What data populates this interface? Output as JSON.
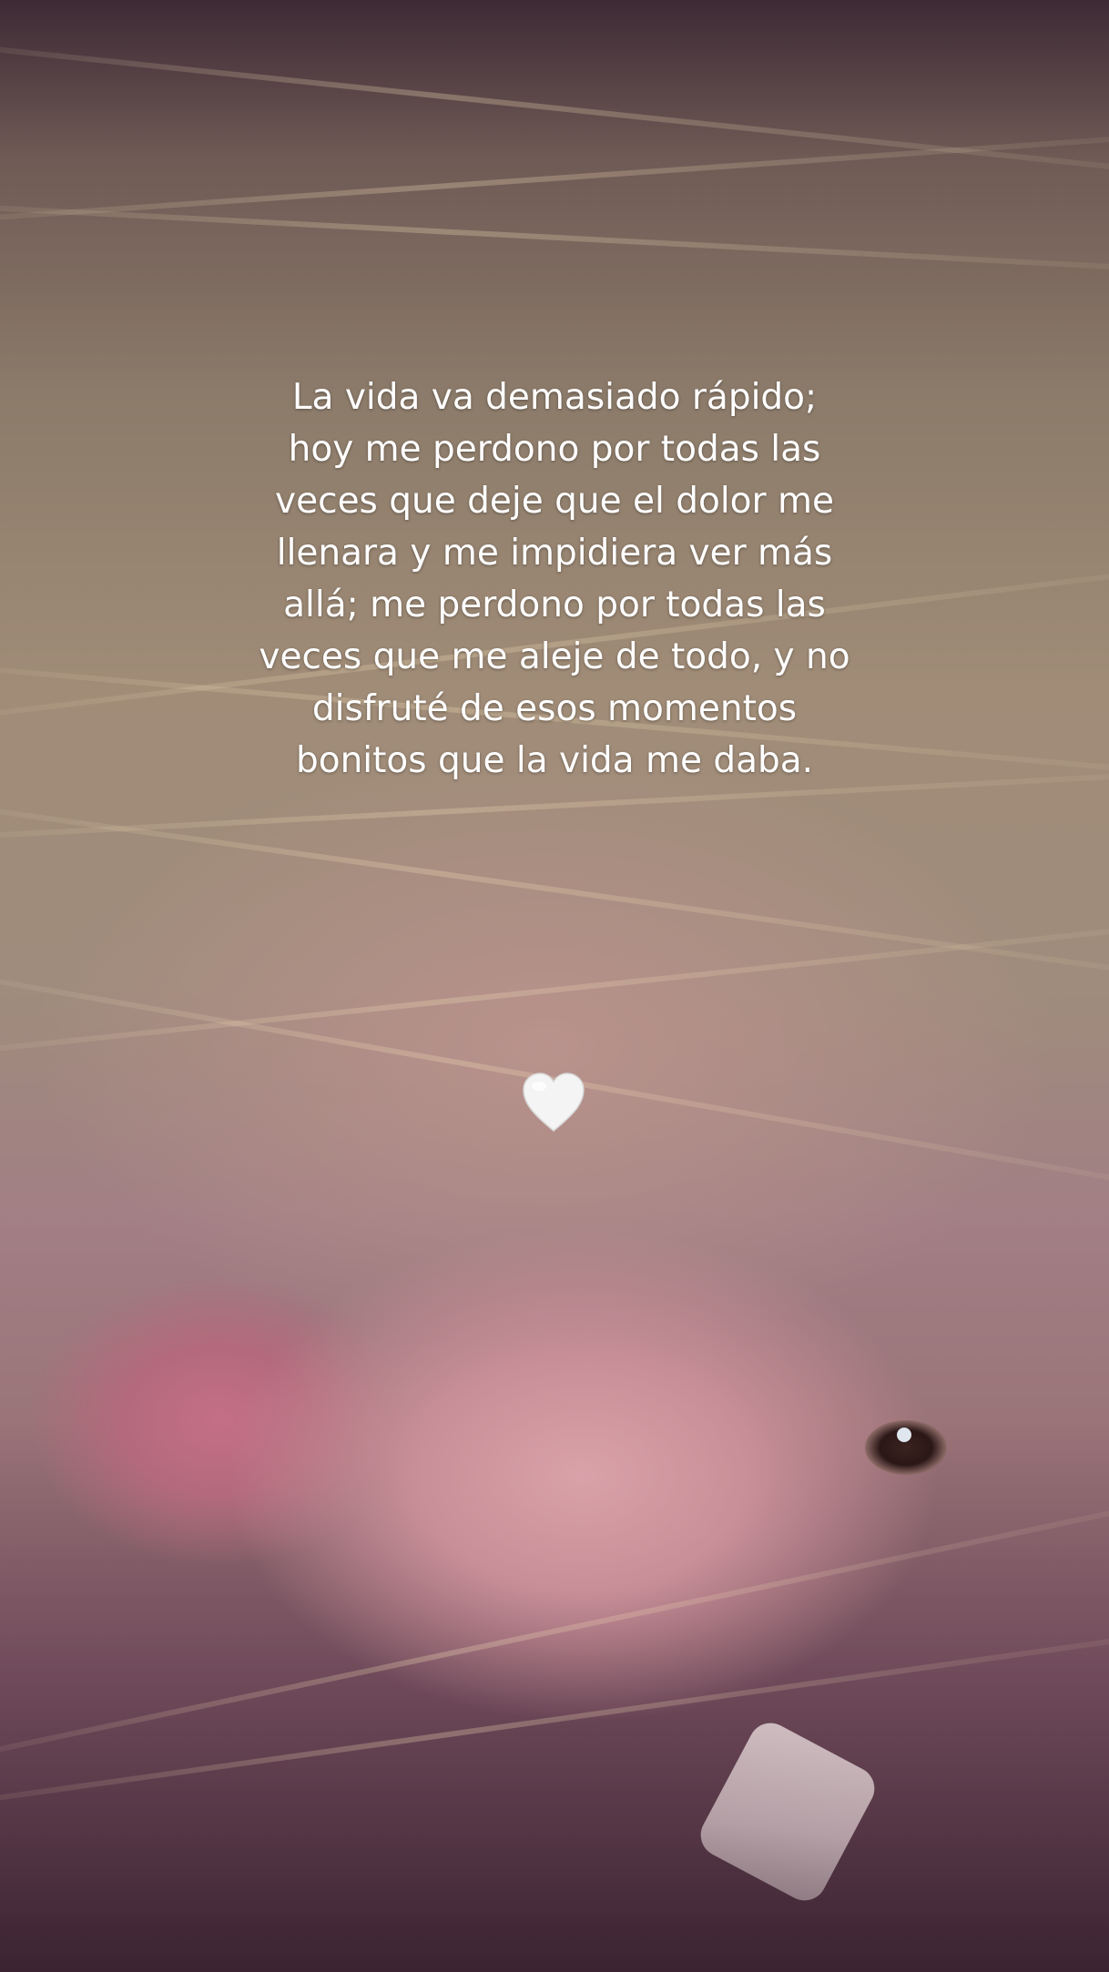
{
  "story": {
    "quote_lines": [
      "La vida va demasiado rápido;",
      "hoy me perdono por todas las",
      "veces que deje que el dolor me",
      "llenara y me impidiera ver más",
      "allá; me perdono por todas las",
      "veces que me aleje de todo, y no",
      "disfruté de esos momentos",
      "bonitos que la vida me daba."
    ],
    "heart_icon": "white-heart-icon",
    "colors": {
      "text": "#ffffff",
      "heart": "#f4f4f4"
    }
  }
}
